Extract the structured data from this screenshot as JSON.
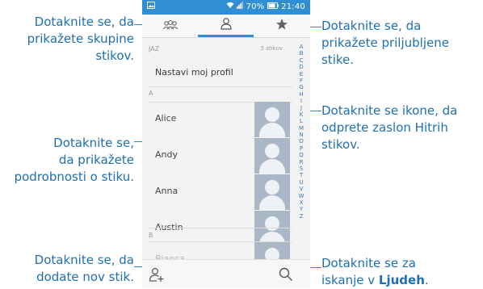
{
  "status_bar": {
    "time": "21:40",
    "battery": "70%"
  },
  "tabs": [
    {
      "icon": "groups-icon"
    },
    {
      "icon": "person-icon"
    },
    {
      "icon": "star-icon"
    }
  ],
  "list": {
    "header": "JAZ",
    "count": "5 stikov",
    "profile_label": "Nastavi moj profil",
    "sections": [
      {
        "letter": "A",
        "contacts": [
          "Alice",
          "Andy",
          "Anna",
          "Austin"
        ]
      },
      {
        "letter": "B",
        "contacts": [
          "Bianca"
        ]
      }
    ]
  },
  "alphabet": [
    "A",
    "B",
    "C",
    "D",
    "E",
    "F",
    "G",
    "H",
    "I",
    "J",
    "K",
    "L",
    "M",
    "N",
    "O",
    "P",
    "Q",
    "R",
    "S",
    "T",
    "U",
    "V",
    "W",
    "X",
    "Y",
    "Z"
  ],
  "bottom_bar": {
    "add_icon": "add-contact-icon",
    "search_icon": "search-icon"
  },
  "annotations": {
    "groups": [
      "Dotaknite se, da",
      "prikažete skupine",
      "stikov."
    ],
    "favorites": [
      "Dotaknite se, da",
      "prikažete priljubljene",
      "stike."
    ],
    "quick_contact": [
      "Dotaknite se ikone, da",
      "odprete zaslon Hitrih",
      "stikov."
    ],
    "details": [
      "Dotaknite se,",
      "da prikažete",
      "podrobnosti o stiku."
    ],
    "add": [
      "Dotaknite se, da",
      "dodate nov stik."
    ],
    "search_line1": "Dotaknite se za",
    "search_prefix": "iskanje v ",
    "search_bold": "Ljudeh",
    "search_suffix": "."
  },
  "colors": {
    "accent": "#2f8fd2",
    "annotation_text": "#1f6fb2"
  }
}
